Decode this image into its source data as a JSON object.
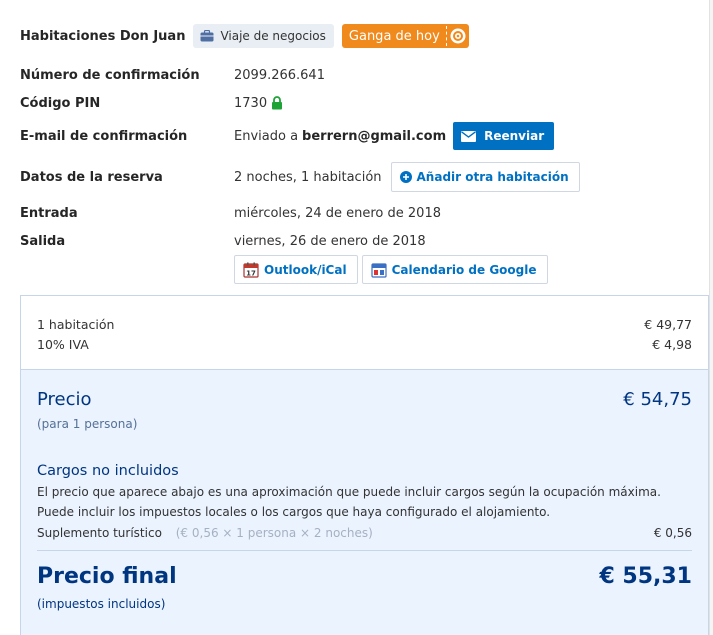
{
  "header": {
    "hotel_name": "Habitaciones Don Juan",
    "trip_badge": "Viaje de negocios",
    "deal_badge": "Ganga de hoy"
  },
  "details": {
    "confirmation_label": "Número de confirmación",
    "confirmation_value": "2099.266.641",
    "pin_label": "Código PIN",
    "pin_value": "1730",
    "email_label": "E-mail de confirmación",
    "email_prefix": "Enviado a",
    "email_value": "berrern@gmail.com",
    "resend_button": "Reenviar",
    "booking_label": "Datos de la reserva",
    "booking_value": "2 noches, 1 habitación",
    "add_room_button": "Añadir otra habitación",
    "checkin_label": "Entrada",
    "checkin_value": "miércoles, 24 de enero de 2018",
    "checkout_label": "Salida",
    "checkout_value": "viernes, 26 de enero de 2018",
    "outlook_button": "Outlook/iCal",
    "google_button": "Calendario de Google"
  },
  "price": {
    "room_label": "1 habitación",
    "room_value": "€ 49,77",
    "vat_label": "10% IVA",
    "vat_value": "€ 4,98",
    "precio_label": "Precio",
    "precio_value": "€ 54,75",
    "precio_note": "(para 1 persona)",
    "cargos_title": "Cargos no incluidos",
    "cargos_line1": "El precio que aparece abajo es una aproximación que puede incluir cargos según la ocupación máxima.",
    "cargos_line2": "Puede incluir los impuestos locales o los cargos que haya configurado el alojamiento.",
    "supl_label": "Suplemento turístico",
    "supl_detail": "(€ 0,56 × 1 persona × 2 noches)",
    "supl_value": "€ 0,56",
    "final_label": "Precio final",
    "final_value": "€ 55,31",
    "final_note": "(impuestos incluidos)"
  },
  "colors": {
    "brand_blue": "#0071c2",
    "dark_blue": "#003580",
    "deal_orange": "#f08a1d",
    "pin_green": "#1ea336"
  },
  "icons": {
    "trip": "briefcase-icon",
    "deal": "deal-tag-icon",
    "pin": "lock-icon",
    "resend": "envelope-icon",
    "add_room": "plus-circle-icon",
    "outlook": "calendar-icon",
    "google": "google-calendar-icon"
  }
}
